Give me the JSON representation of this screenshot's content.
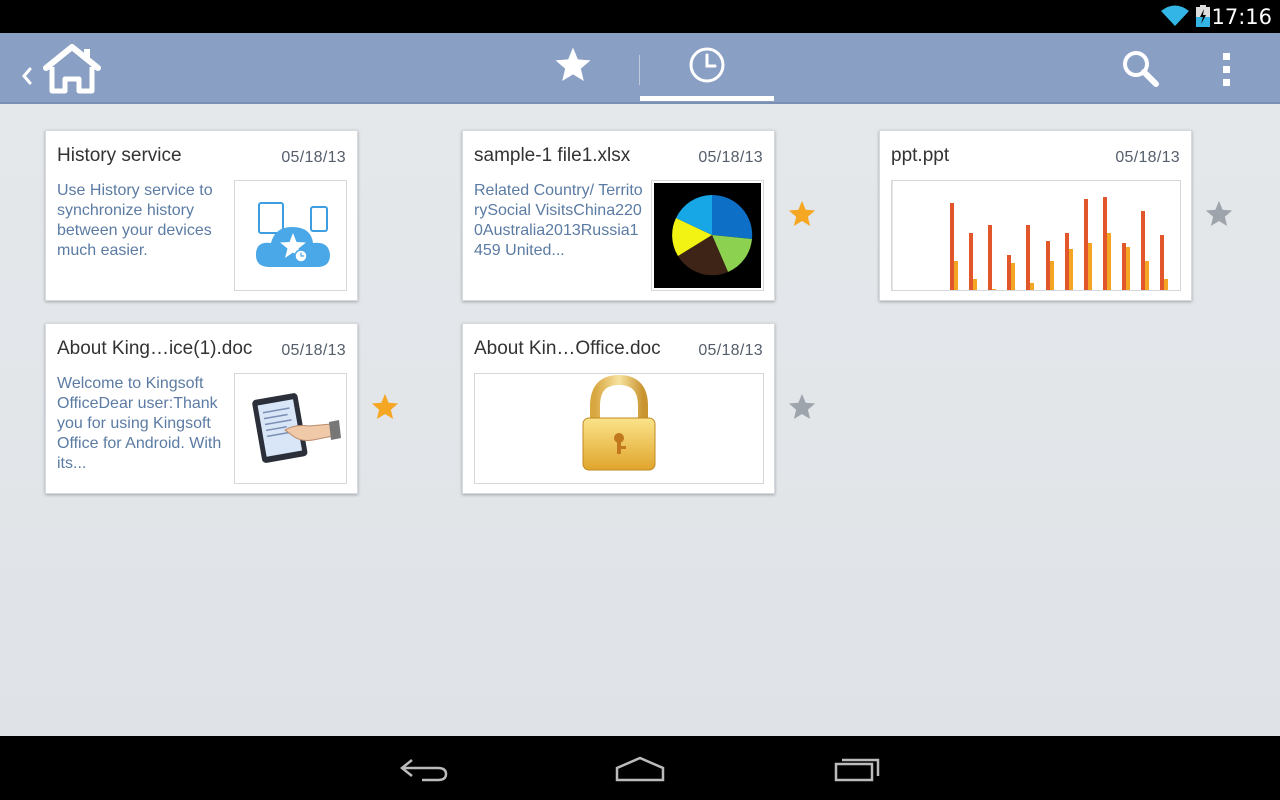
{
  "status_bar": {
    "time": "17:16",
    "icons": [
      "wifi-icon",
      "battery-charging-icon"
    ]
  },
  "action_bar": {
    "home_icon": "home-icon",
    "tabs": [
      {
        "icon": "star-icon",
        "name": "starred",
        "active": false
      },
      {
        "icon": "clock-icon",
        "name": "recent",
        "active": true
      }
    ],
    "actions": [
      "search-icon",
      "overflow-menu-icon"
    ]
  },
  "cards": [
    {
      "title": "History service",
      "date": "05/18/13",
      "description": "Use History service to synchronize history between your devices much easier.",
      "thumbnail": "cloud-sync-icon",
      "starred": null
    },
    {
      "title": "sample-1 file1.xlsx",
      "date": "05/18/13",
      "description": "Related Country/ TerritorySocial VisitsChina2200Australia2013Russia1459 United...",
      "thumbnail": "pie-chart-preview",
      "starred": true
    },
    {
      "title": "ppt.ppt",
      "date": "05/18/13",
      "description": "",
      "thumbnail": "bar-chart-preview",
      "starred": false
    },
    {
      "title": "About King…ice(1).doc",
      "date": "05/18/13",
      "description": "Welcome to Kingsoft OfficeDear user:Thank you for using Kingsoft Office for Android. With its...",
      "thumbnail": "tablet-hand-preview",
      "starred": true
    },
    {
      "title": "About Kin…Office.doc",
      "date": "05/18/13",
      "description": "",
      "thumbnail": "padlock-preview",
      "starred": false
    }
  ],
  "colors": {
    "action_bar": "#8a9fc4",
    "star_active": "#f5a623",
    "star_inactive": "#9ea4ab",
    "description_text": "#5b7ba3"
  },
  "nav_bar": [
    "back-icon",
    "home-nav-icon",
    "recents-icon"
  ]
}
